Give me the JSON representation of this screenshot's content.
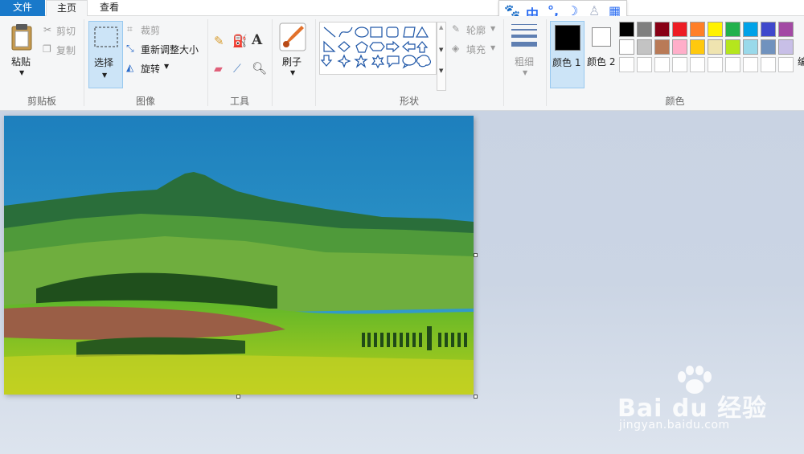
{
  "tabs": {
    "file": "文件",
    "home": "主页",
    "view": "查看"
  },
  "clipboard": {
    "paste": "粘贴",
    "cut": "剪切",
    "copy": "复制",
    "group": "剪贴板"
  },
  "image": {
    "select": "选择",
    "crop": "裁剪",
    "resize": "重新调整大小",
    "rotate": "旋转",
    "group": "图像"
  },
  "tools": {
    "group": "工具"
  },
  "brushes": {
    "label": "刷子"
  },
  "shapes": {
    "outline": "轮廓",
    "fill": "填充",
    "group": "形状"
  },
  "size": {
    "label": "粗细"
  },
  "colors": {
    "color1": "颜色 1",
    "color2": "颜色 2",
    "group": "颜色",
    "edit_partial": "编",
    "row1": [
      "#000000",
      "#7f7f7f",
      "#880015",
      "#ed1c24",
      "#ff7f27",
      "#fff200",
      "#22b14c",
      "#00a2e8",
      "#3f48cc",
      "#a349a4"
    ],
    "row2": [
      "#ffffff",
      "#c3c3c3",
      "#b97a57",
      "#ffaec9",
      "#ffc90e",
      "#efe4b0",
      "#b5e61d",
      "#99d9ea",
      "#7092be",
      "#c8bfe7"
    ]
  },
  "ime": {
    "lang": "中"
  },
  "watermark": {
    "brand": "Bai du 经验",
    "url": "jingyan.baidu.com"
  }
}
